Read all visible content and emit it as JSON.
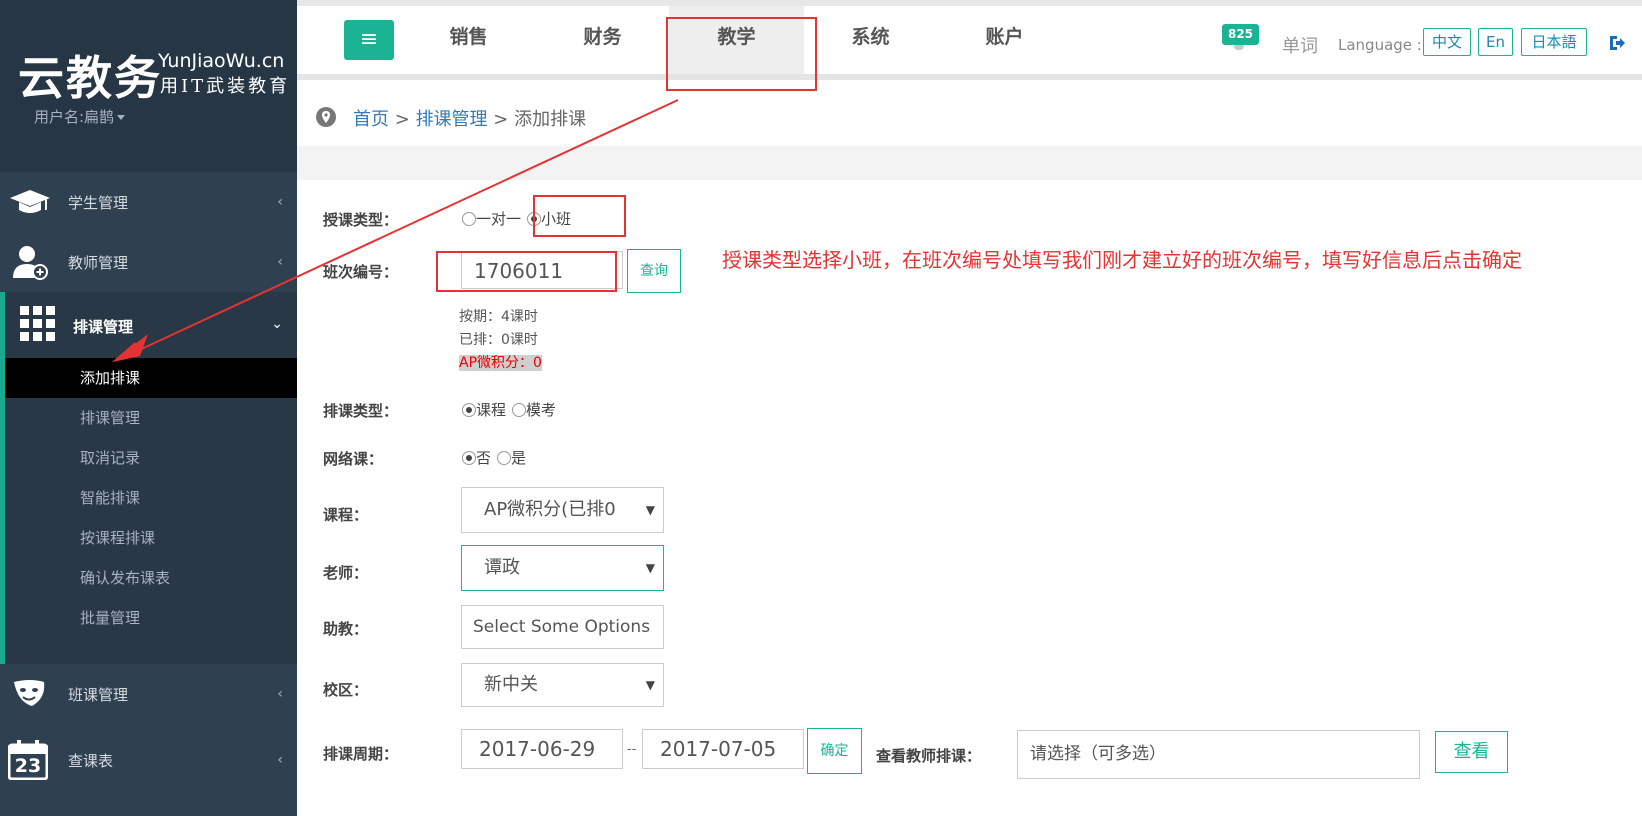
{
  "brand": {
    "name": "云教务",
    "domain": "YunJiaoWu.cn",
    "slogan": "用IT武装教育",
    "username": "用户名:扁鹊"
  },
  "sidebar": {
    "items": [
      {
        "label": "学生管理",
        "icon": "graduation-cap-icon"
      },
      {
        "label": "教师管理",
        "icon": "teacher-add-icon"
      },
      {
        "label": "排课管理",
        "icon": "grid-icon"
      },
      {
        "label": "班课管理",
        "icon": "mask-icon"
      },
      {
        "label": "查课表",
        "icon": "calendar-icon"
      }
    ],
    "calendar_day": "23",
    "submenu": [
      "添加排课",
      "排课管理",
      "取消记录",
      "智能排课",
      "按课程排课",
      "确认发布课表",
      "批量管理"
    ]
  },
  "topbar": {
    "tabs": [
      "销售",
      "财务",
      "教学",
      "系统",
      "账户"
    ],
    "badge": "825",
    "words": "单词",
    "language_label": "Language :",
    "languages": [
      "中文",
      "En",
      "日本語"
    ]
  },
  "breadcrumb": {
    "home": "首页",
    "sep": ">",
    "section": "排课管理",
    "current": "添加排课"
  },
  "form": {
    "teach_type": {
      "label": "授课类型：",
      "options": [
        "一对一",
        "小班"
      ]
    },
    "class_no": {
      "label": "班次编号：",
      "value": "1706011",
      "query_btn": "查询"
    },
    "info": {
      "period": "按期：4课时",
      "scheduled": "已排：0课时",
      "course_note": "AP微积分：0"
    },
    "schedule_type": {
      "label": "排课类型：",
      "options": [
        "课程",
        "模考"
      ]
    },
    "online": {
      "label": "网络课：",
      "options": [
        "否",
        "是"
      ]
    },
    "course": {
      "label": "课程：",
      "value": "AP微积分(已排0"
    },
    "teacher": {
      "label": "老师：",
      "value": "谭政"
    },
    "assistant": {
      "label": "助教：",
      "placeholder": "Select Some Options"
    },
    "campus": {
      "label": "校区：",
      "value": "新中关"
    },
    "period": {
      "label": "排课周期：",
      "start": "2017-06-29",
      "dash": "--",
      "end": "2017-07-05",
      "confirm_btn": "确定"
    },
    "view_teacher": {
      "label": "查看教师排课：",
      "placeholder": "请选择（可多选）",
      "view_btn": "查看"
    }
  },
  "annotation": {
    "note": "授课类型选择小班，在班次编号处填写我们刚才建立好的班次编号，填写好信息后点击确定",
    "color": "#e53333"
  },
  "colors": {
    "accent": "#1ab394",
    "sidebar": "#2f4050",
    "link": "#337ab7"
  }
}
